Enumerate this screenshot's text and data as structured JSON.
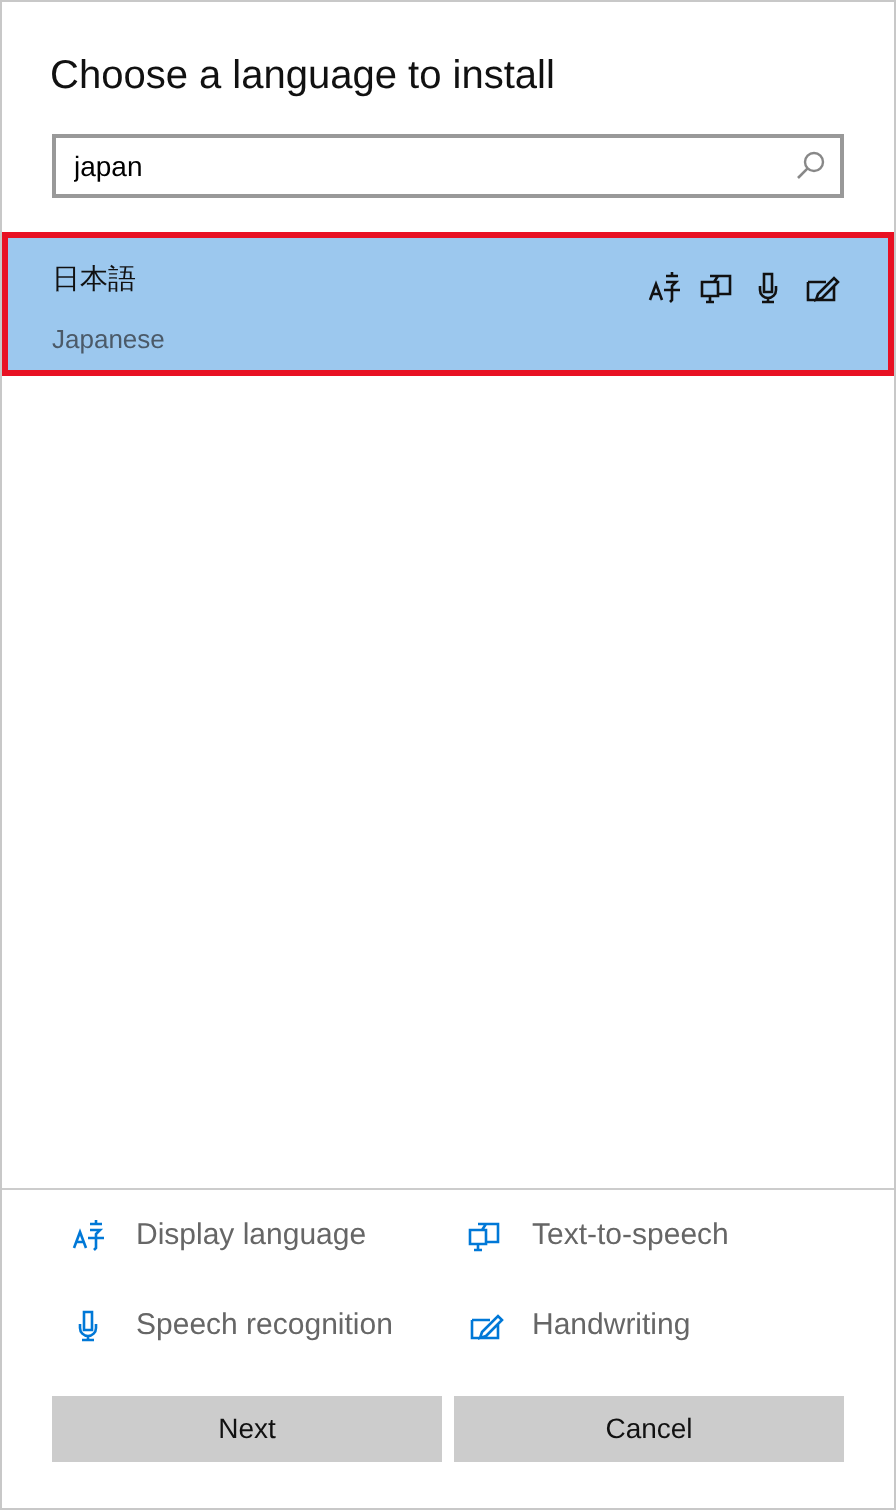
{
  "title": "Choose a language to install",
  "search": {
    "value": "japan"
  },
  "languages": [
    {
      "native": "日本語",
      "english": "Japanese",
      "selected": true,
      "outlined": true,
      "features": [
        {
          "kind": "display"
        },
        {
          "kind": "tts"
        },
        {
          "kind": "speech"
        },
        {
          "kind": "handwriting"
        }
      ]
    }
  ],
  "legend": [
    {
      "kind": "display",
      "label": "Display language"
    },
    {
      "kind": "tts",
      "label": "Text-to-speech"
    },
    {
      "kind": "speech",
      "label": "Speech recognition"
    },
    {
      "kind": "handwriting",
      "label": "Handwriting"
    }
  ],
  "buttons": [
    "Next",
    "Cancel"
  ]
}
